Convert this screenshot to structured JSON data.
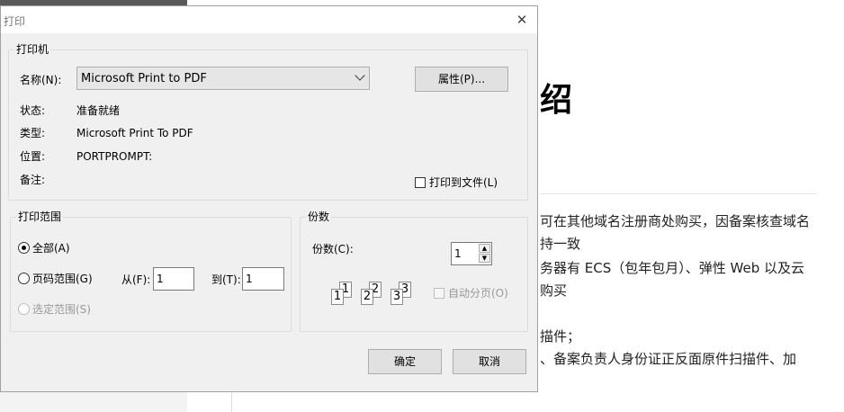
{
  "background_doc": {
    "heading": "绍",
    "lines": [
      "可在其他域名注册商处购买，因备案核查域名",
      "持一致",
      "务器有 ECS（包年包月）、弹性 Web 以及云",
      "购买",
      "",
      "描件；",
      "、备案负责人身份证正反面原件扫描件、加"
    ]
  },
  "dialog": {
    "title": "打印",
    "close_glyph": "✕",
    "printer": {
      "group_label": "打印机",
      "name_label": "名称(N):",
      "name_value": "Microsoft Print to PDF",
      "properties_button": "属性(P)...",
      "status_label": "状态:",
      "status_value": "准备就绪",
      "type_label": "类型:",
      "type_value": "Microsoft Print To PDF",
      "location_label": "位置:",
      "location_value": "PORTPROMPT:",
      "comment_label": "备注:",
      "print_to_file_label": "打印到文件(L)",
      "print_to_file_checked": false
    },
    "range": {
      "group_label": "打印范围",
      "all_label": "全部(A)",
      "pages_label": "页码范围(G)",
      "from_label": "从(F):",
      "from_value": "1",
      "to_label": "到(T):",
      "to_value": "1",
      "selection_label": "选定范围(S)",
      "selected": "all"
    },
    "copies": {
      "group_label": "份数",
      "copies_label": "份数(C):",
      "copies_value": "1",
      "collate_label": "自动分页(O)",
      "collate_checked": false,
      "collate_pages": [
        "1",
        "1",
        "2",
        "2",
        "3",
        "3"
      ]
    },
    "ok_button": "确定",
    "cancel_button": "取消"
  }
}
